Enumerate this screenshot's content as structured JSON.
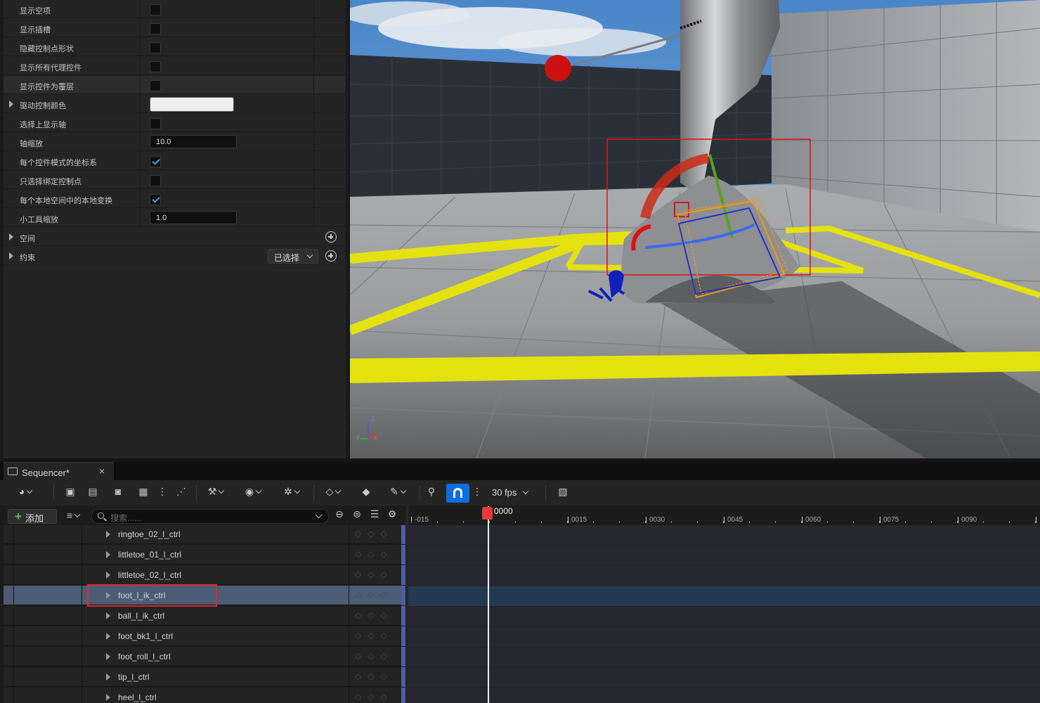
{
  "details": {
    "rows": [
      {
        "label": "显示空项",
        "type": "checkbox",
        "checked": false
      },
      {
        "label": "显示插槽",
        "type": "checkbox",
        "checked": false
      },
      {
        "label": "隐藏控制点形状",
        "type": "checkbox",
        "checked": false
      },
      {
        "label": "显示所有代理控件",
        "type": "checkbox",
        "checked": false
      },
      {
        "label": "显示控件为覆层",
        "type": "checkbox",
        "checked": false
      },
      {
        "label": "驱动控制颜色",
        "type": "color",
        "color": "#EDEDED"
      },
      {
        "label": "选择上显示轴",
        "type": "checkbox",
        "checked": false
      },
      {
        "label": "轴缩放",
        "type": "number",
        "value": "10.0"
      },
      {
        "label": "每个控件模式的坐标系",
        "type": "checkbox",
        "checked": true
      },
      {
        "label": "只选择绑定控制点",
        "type": "checkbox",
        "checked": false
      },
      {
        "label": "每个本地空间中的本地变换",
        "type": "checkbox",
        "checked": true
      },
      {
        "label": "小工具缩放",
        "type": "number",
        "value": "1.0"
      }
    ],
    "sections": [
      {
        "label": "空间"
      },
      {
        "label": "约束",
        "dropdown": "已选择"
      }
    ]
  },
  "viewport": {
    "axis_labels": {
      "y": "Y",
      "z": "Z",
      "x": "X"
    }
  },
  "sequencer": {
    "tab_title": "Sequencer*",
    "tab_close": "×",
    "fps": "30 fps",
    "add_label": "添加",
    "search_placeholder": "搜索......",
    "tracks": [
      {
        "name": "ringtoe_02_l_ctrl",
        "selected": false
      },
      {
        "name": "littletoe_01_l_ctrl",
        "selected": false
      },
      {
        "name": "littletoe_02_l_ctrl",
        "selected": false
      },
      {
        "name": "foot_l_ik_ctrl",
        "selected": true
      },
      {
        "name": "ball_l_ik_ctrl",
        "selected": false
      },
      {
        "name": "foot_bk1_l_ctrl",
        "selected": false
      },
      {
        "name": "foot_roll_l_ctrl",
        "selected": false
      },
      {
        "name": "tip_l_ctrl",
        "selected": false
      },
      {
        "name": "heel_l_ctrl",
        "selected": false
      }
    ],
    "key_glyphs": "◇◇◇",
    "ruler_labels": [
      "-015",
      "0015",
      "0030",
      "0045",
      "0060",
      "0075",
      "0090"
    ],
    "playhead_frame": "0000",
    "colors": {
      "accent": "#0D6EE0",
      "playhead": "#E93838",
      "highlight": "#E02A2A",
      "selected_row": "#4B5C74"
    }
  }
}
